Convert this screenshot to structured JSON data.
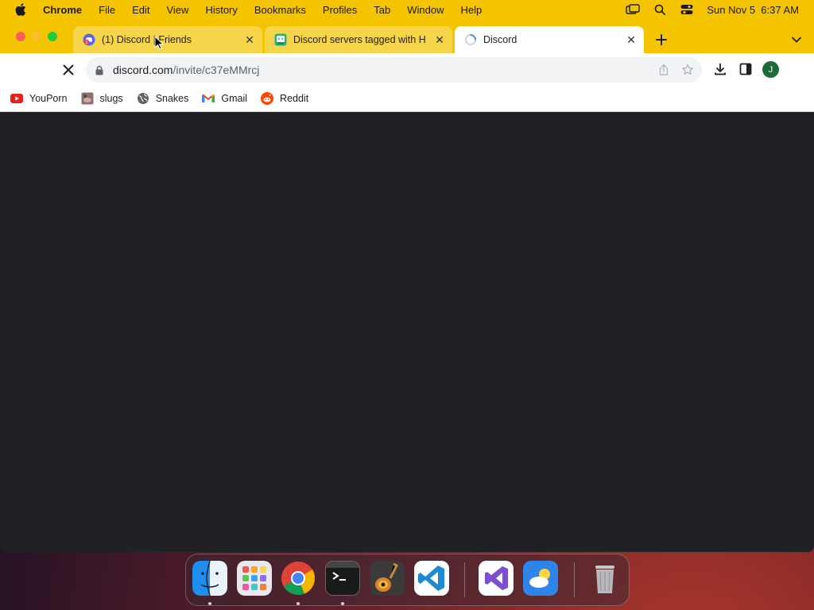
{
  "menubar": {
    "app_name": "Chrome",
    "items": [
      "File",
      "Edit",
      "View",
      "History",
      "Bookmarks",
      "Profiles",
      "Tab",
      "Window",
      "Help"
    ],
    "clock": "Sun Nov 5  6:37 AM"
  },
  "tabs": [
    {
      "title": "(1) Discord | Friends",
      "favicon": "discord-notification-icon",
      "active": false
    },
    {
      "title": "Discord servers tagged with H",
      "favicon": "disboard-icon",
      "active": false
    },
    {
      "title": "Discord",
      "favicon": "loading-spinner-icon",
      "active": true
    }
  ],
  "toolbar": {
    "url_host": "discord.com",
    "url_path": "/invite/c37eMMrcj",
    "avatar_letter": "J"
  },
  "bookmarks": [
    {
      "label": "YouPorn",
      "icon": "youtube-red-icon"
    },
    {
      "label": "slugs",
      "icon": "image-thumb-icon"
    },
    {
      "label": "Snakes",
      "icon": "globe-icon"
    },
    {
      "label": "Gmail",
      "icon": "gmail-icon"
    },
    {
      "label": "Reddit",
      "icon": "reddit-icon"
    }
  ],
  "dock": [
    "Finder",
    "Launchpad",
    "Google Chrome",
    "Terminal",
    "GarageBand",
    "Visual Studio Code",
    "Visual Studio",
    "Weather",
    "Trash"
  ],
  "colors": {
    "accent": "#f5c400",
    "page_background": "#202124"
  }
}
